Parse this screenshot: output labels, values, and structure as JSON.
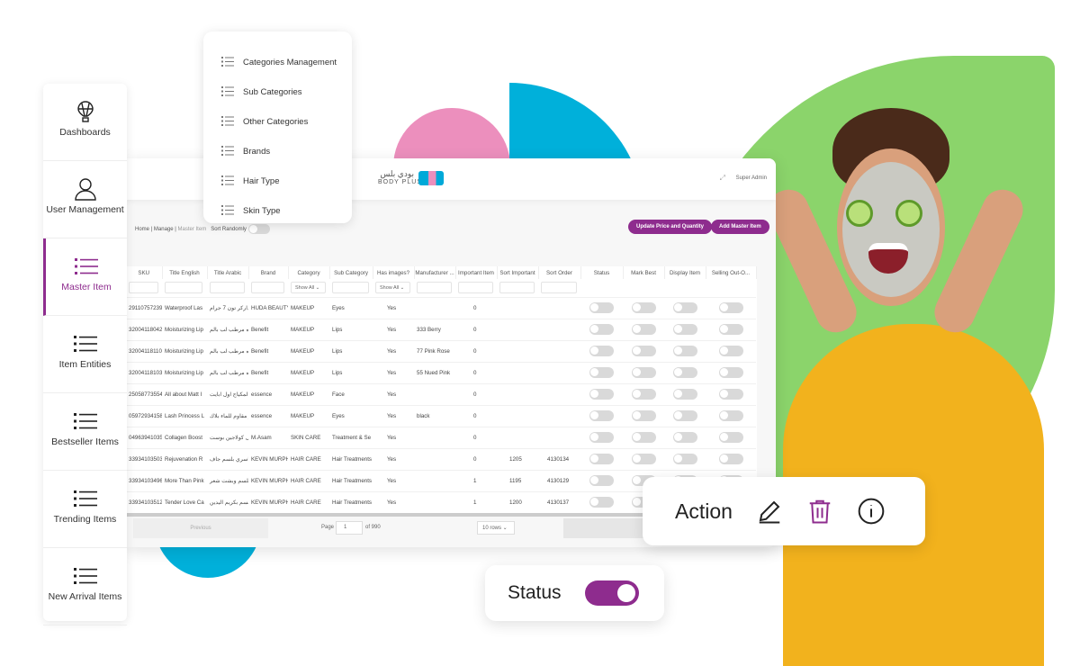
{
  "sidebar": {
    "items": [
      {
        "label": "Dashboards",
        "icon": "balloon-icon"
      },
      {
        "label": "User Management",
        "icon": "user-icon"
      },
      {
        "label": "Master Item",
        "icon": "list-icon",
        "active": true
      },
      {
        "label": "Item Entities",
        "icon": "list-icon"
      },
      {
        "label": "Bestseller Items",
        "icon": "list-icon"
      },
      {
        "label": "Trending Items",
        "icon": "list-icon"
      },
      {
        "label": "New Arrival Items",
        "icon": "list-icon"
      }
    ]
  },
  "dropdown": {
    "items": [
      "Categories Management",
      "Sub Categories",
      "Other Categories",
      "Brands",
      "Hair Type",
      "Skin Type"
    ]
  },
  "header": {
    "logo_ar": "بودي بلس",
    "logo_en": "BODY PLUS",
    "user": "Super Admin"
  },
  "breadcrumb": {
    "home": "Home",
    "manage": "Manage",
    "current": "Master Item",
    "sort_label": "Sort Randomly"
  },
  "buttons": {
    "update": "Update Price and Quantity",
    "add": "Add Master Item"
  },
  "table": {
    "columns": [
      "SKU",
      "Title English",
      "Title Arabic",
      "Brand",
      "Category",
      "Sub Category",
      "Has images?",
      "Manufacturer ...",
      "Important Item",
      "Sort Important",
      "Sort Order",
      "Status",
      "Mark Best",
      "Display Item",
      "Selling Out-O..."
    ],
    "filter_show_all": "Show All",
    "rows": [
      [
        "29110757239",
        "Waterproof Las",
        "ماسكارا داركر تون 7 جرام",
        "HUDA BEAUTY",
        "MAKEUP",
        "Eyes",
        "Yes",
        "",
        "0",
        "",
        ""
      ],
      [
        "32004118042",
        "Moisturizing Lip",
        "شفاه مرطب لب بالم",
        "Benefit",
        "MAKEUP",
        "Lips",
        "Yes",
        "333 Berry",
        "0",
        "",
        ""
      ],
      [
        "32004118110",
        "Moisturizing Lip",
        "شفاه مرطب لب بالم",
        "Benefit",
        "MAKEUP",
        "Lips",
        "Yes",
        "77 Pink Rose",
        "0",
        "",
        ""
      ],
      [
        "32004118103",
        "Moisturizing Lip",
        "شفاه مرطب لب بالم",
        "Benefit",
        "MAKEUP",
        "Lips",
        "Yes",
        "55 Nued Pink",
        "0",
        "",
        ""
      ],
      [
        "25058773554",
        "All about Matt I",
        "ثبت المكياج اول ابايت",
        "essence",
        "MAKEUP",
        "Face",
        "Yes",
        "",
        "0",
        "",
        ""
      ],
      [
        "05972934158",
        "Lash Princess L",
        "كيلر مقاوم للماء بلاك",
        "essence",
        "MAKEUP",
        "Eyes",
        "Yes",
        "black",
        "0",
        "",
        ""
      ],
      [
        "04963941035",
        "Collagen Boost",
        "واثيل كولاجين بوست",
        "M.Asam",
        "SKIN CARE",
        "Treatment & Se",
        "Yes",
        "",
        "0",
        "",
        ""
      ],
      [
        "33934103503",
        "Rejuvenation R",
        "واسري بلسم جاف",
        "KEVIN MURPHY",
        "HAIR CARE",
        "Hair Treatments",
        "Yes",
        "",
        "0",
        "1205",
        "4130134"
      ],
      [
        "33934103496",
        "More Than Pink",
        "و ويلسم وبشت شعر",
        "KEVIN MURPHY",
        "HAIR CARE",
        "Hair Treatments",
        "Yes",
        "",
        "1",
        "1195",
        "4130129"
      ],
      [
        "33934103512",
        "Tender Love Ca",
        "ويلسم بكريم اليدين",
        "KEVIN MURPHY",
        "HAIR CARE",
        "Hair Treatments",
        "Yes",
        "",
        "1",
        "1200",
        "4130137"
      ]
    ]
  },
  "pagination": {
    "previous": "Previous",
    "page_label": "Page",
    "page": "1",
    "of": "of 990",
    "rows": "10 rows"
  },
  "action_card": {
    "label": "Action",
    "icons": [
      "pencil-icon",
      "trash-icon",
      "info-icon"
    ]
  },
  "status_card": {
    "label": "Status",
    "on": true
  },
  "colors": {
    "accent": "#8e2c8e",
    "green": "#8bd46b",
    "cyan": "#00b0da",
    "pink": "#ec8fbd"
  }
}
